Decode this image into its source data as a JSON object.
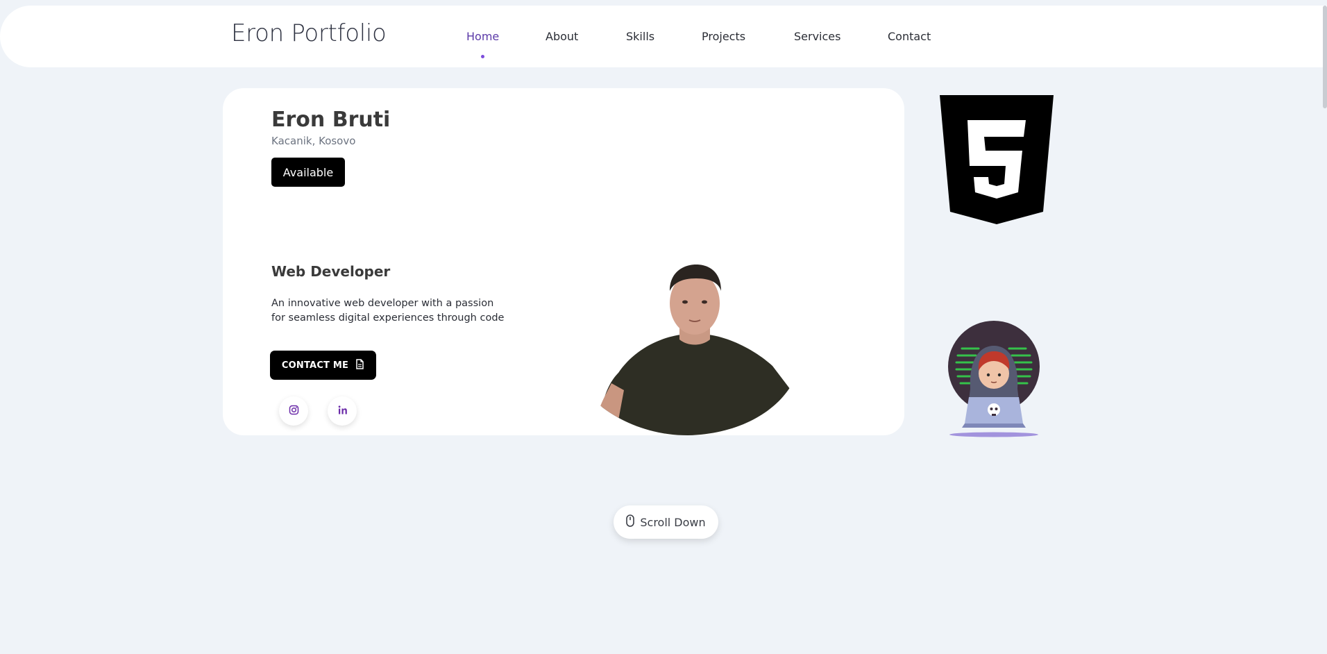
{
  "header": {
    "brand": "Eron Portfolio",
    "nav": [
      {
        "label": "Home",
        "active": true
      },
      {
        "label": "About",
        "active": false
      },
      {
        "label": "Skills",
        "active": false
      },
      {
        "label": "Projects",
        "active": false
      },
      {
        "label": "Services",
        "active": false
      },
      {
        "label": "Contact",
        "active": false
      }
    ]
  },
  "hero": {
    "name": "Eron Bruti",
    "location": "Kacanik, Kosovo",
    "status_badge": "Available",
    "role": "Web Developer",
    "description_line1": "An innovative web developer with a passion",
    "description_line2": "for seamless digital experiences through code",
    "contact_button": "CONTACT ME",
    "contact_icon": "document-icon",
    "socials": [
      {
        "icon": "instagram-icon"
      },
      {
        "icon": "linkedin-icon"
      }
    ]
  },
  "decor": {
    "html5_icon": "html5-logo-icon",
    "illustration": "hacker-with-laptop-illustration"
  },
  "scroll": {
    "label": "Scroll Down",
    "icon": "mouse-icon"
  },
  "colors": {
    "background": "#eff3f8",
    "accent": "#5b3aa8",
    "dark": "#000000",
    "card": "#ffffff"
  }
}
